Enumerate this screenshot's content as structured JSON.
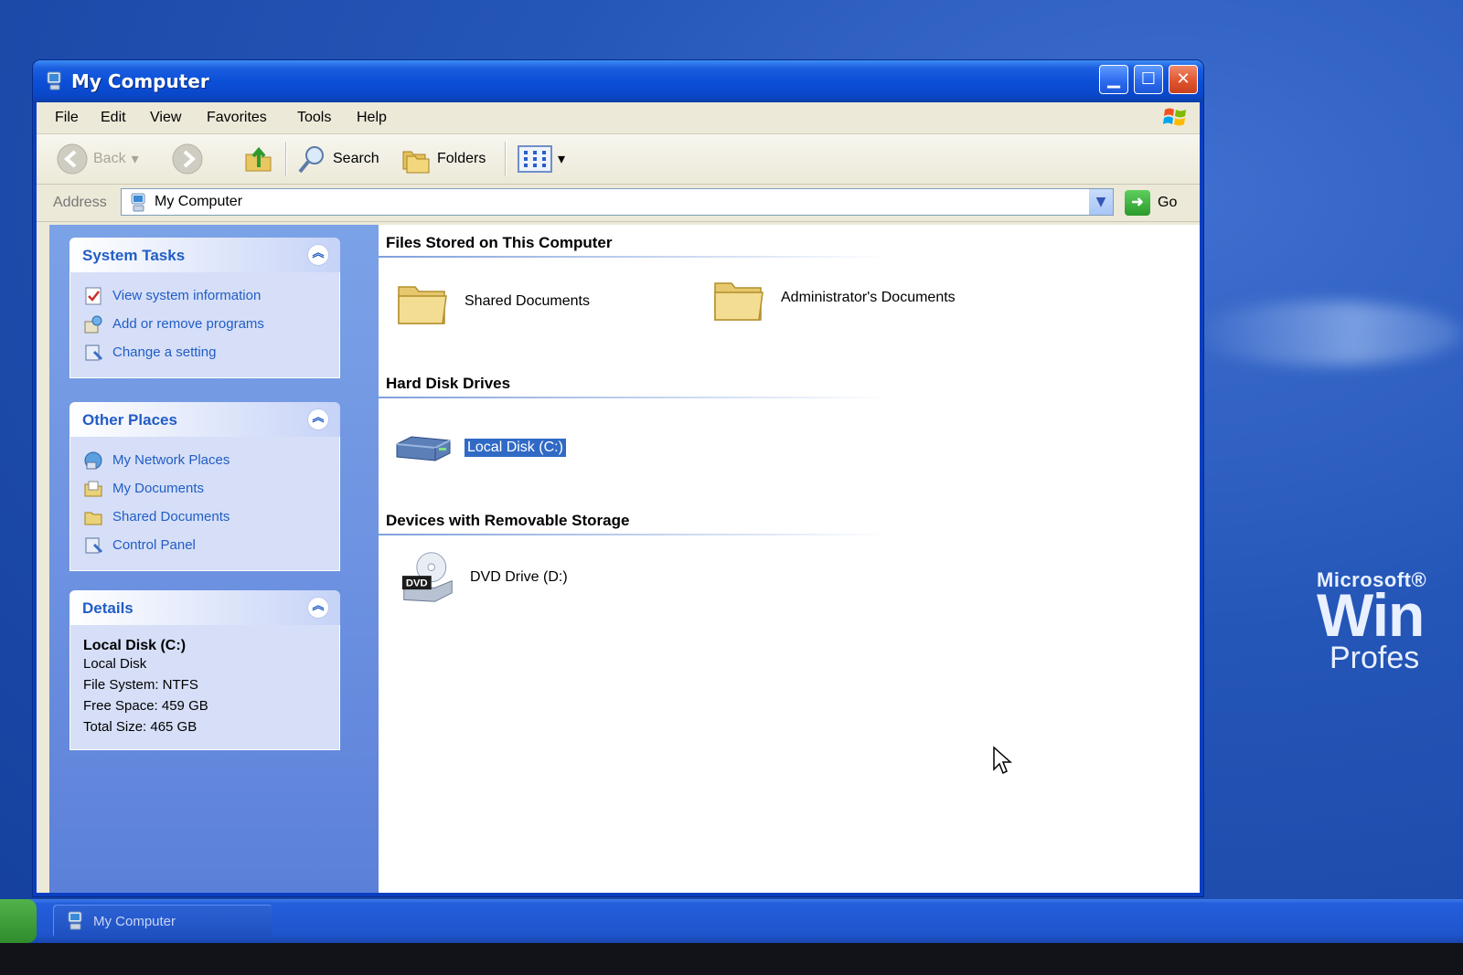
{
  "window": {
    "title": "My Computer",
    "controls": {
      "minimize": "▁",
      "maximize": "☐",
      "close": "✕"
    }
  },
  "menubar": {
    "items": [
      "File",
      "Edit",
      "View",
      "Favorites",
      "Tools",
      "Help"
    ]
  },
  "toolbar": {
    "back_label": "Back",
    "search_label": "Search",
    "folders_label": "Folders",
    "views_icon": "views-grid-icon"
  },
  "address": {
    "label": "Address",
    "value": "My Computer",
    "go_label": "Go"
  },
  "left_pane": {
    "system_tasks": {
      "title": "System Tasks",
      "items": [
        {
          "label": "View system information",
          "icon": "system-info-icon"
        },
        {
          "label": "Add or remove programs",
          "icon": "add-remove-programs-icon"
        },
        {
          "label": "Change a setting",
          "icon": "control-panel-icon"
        }
      ]
    },
    "other_places": {
      "title": "Other Places",
      "items": [
        {
          "label": "My Network Places",
          "icon": "network-places-icon"
        },
        {
          "label": "My Documents",
          "icon": "my-documents-icon"
        },
        {
          "label": "Shared Documents",
          "icon": "folder-icon"
        },
        {
          "label": "Control Panel",
          "icon": "control-panel-icon"
        }
      ]
    },
    "details": {
      "title": "Details",
      "name": "Local Disk (C:)",
      "type": "Local Disk",
      "file_system": "File System: NTFS",
      "free_space": "Free Space: 459 GB",
      "total_size": "Total Size: 465 GB"
    }
  },
  "content": {
    "files_section": {
      "title": "Files Stored on This Computer",
      "items": [
        {
          "label": "Shared Documents",
          "icon": "folder-icon"
        },
        {
          "label": "Administrator's Documents",
          "icon": "folder-icon"
        }
      ]
    },
    "hard_disks_section": {
      "title": "Hard Disk Drives",
      "items": [
        {
          "label": "Local Disk (C:)",
          "icon": "hard-disk-icon",
          "selected": true
        }
      ]
    },
    "removable_section": {
      "title": "Devices with Removable Storage",
      "items": [
        {
          "label": "DVD Drive (D:)",
          "icon": "dvd-drive-icon",
          "badge": "DVD"
        }
      ]
    }
  },
  "taskbar": {
    "task_label": "My Computer"
  },
  "desktop": {
    "brand_small": "Microsoft®",
    "brand_big": "Win",
    "brand_edition": "Profes"
  },
  "colors": {
    "titlebar_blue": "#0a46c8",
    "link_blue": "#215dc6",
    "selection_blue": "#316ac5",
    "task_pane": "#6a8fe0"
  }
}
